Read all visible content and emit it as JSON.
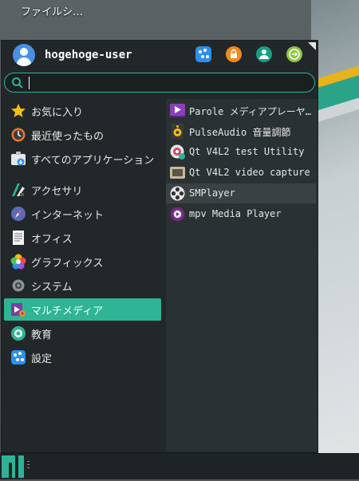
{
  "desktop": {
    "icon_label": "ファイルシ…"
  },
  "user": {
    "name": "hogehoge-user"
  },
  "header_buttons": [
    {
      "icon": "settings-manager-icon",
      "color": "#2d8ff0"
    },
    {
      "icon": "lock-screen-icon",
      "color": "#f28a1b"
    },
    {
      "icon": "switch-user-icon",
      "color": "#14a085"
    },
    {
      "icon": "logout-icon",
      "color": "#8dc63f"
    }
  ],
  "search": {
    "value": "",
    "placeholder": ""
  },
  "categories": [
    {
      "label": "お気に入り",
      "icon": "favorites-star-icon"
    },
    {
      "label": "最近使ったもの",
      "icon": "recent-clock-icon"
    },
    {
      "label": "すべてのアプリケーション",
      "icon": "all-applications-icon"
    },
    {
      "label": "アクセサリ",
      "icon": "accessories-icon"
    },
    {
      "label": "インターネット",
      "icon": "internet-compass-icon"
    },
    {
      "label": "オフィス",
      "icon": "office-document-icon"
    },
    {
      "label": "グラフィックス",
      "icon": "graphics-palette-icon"
    },
    {
      "label": "システム",
      "icon": "system-gear-icon"
    },
    {
      "label": "マルチメディア",
      "icon": "multimedia-icon",
      "selected": true
    },
    {
      "label": "教育",
      "icon": "education-icon"
    },
    {
      "label": "設定",
      "icon": "settings-icon"
    }
  ],
  "apps": [
    {
      "label": "Parole メディアプレーヤー",
      "icon": "parole-player-icon"
    },
    {
      "label": "PulseAudio 音量調節",
      "icon": "speaker-icon"
    },
    {
      "label": "Qt V4L2 test Utility",
      "icon": "webcam-test-icon"
    },
    {
      "label": "Qt V4L2 video capture",
      "icon": "video-capture-icon"
    },
    {
      "label": "SMPlayer",
      "icon": "smplayer-reel-icon",
      "hover": true
    },
    {
      "label": "mpv Media Player",
      "icon": "mpv-icon"
    }
  ],
  "colors": {
    "accent": "#30b496",
    "menu_bg": "#22282a",
    "apps_bg": "#2a3133"
  }
}
